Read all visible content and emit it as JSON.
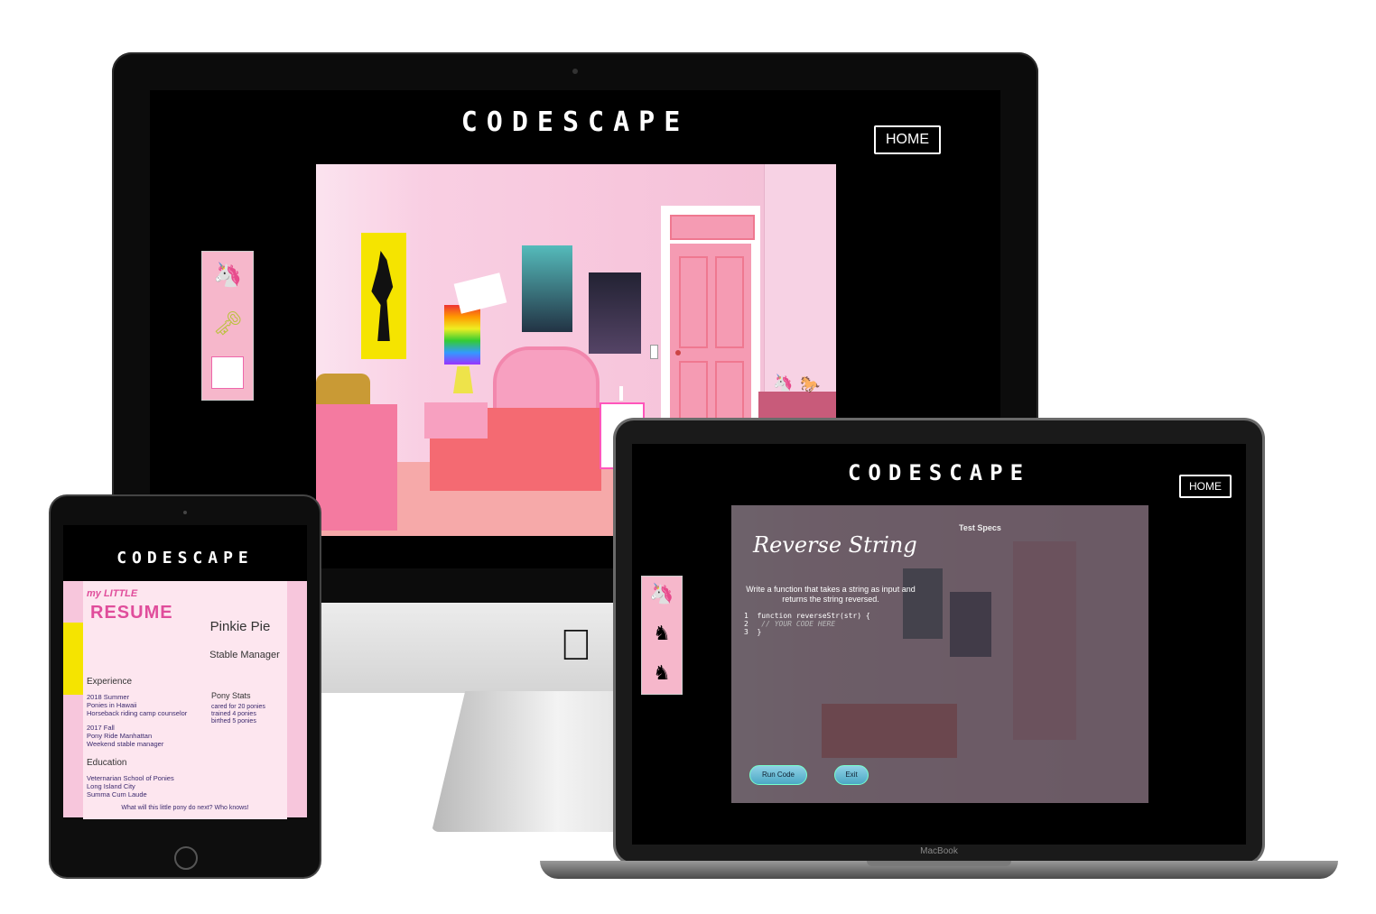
{
  "brand": {
    "title": "CODESCAPE"
  },
  "nav": {
    "home_label": "HOME"
  },
  "macbook": {
    "label": "MacBook"
  },
  "challenge": {
    "title": "Reverse String",
    "test_specs_label": "Test Specs",
    "prompt": "Write a function that takes a string as input and returns the string reversed.",
    "code_lines": [
      {
        "num": "1",
        "text": "function reverseStr(str) {"
      },
      {
        "num": "2",
        "text": "  // YOUR CODE HERE"
      },
      {
        "num": "3",
        "text": "}"
      }
    ],
    "run_label": "Run Code",
    "exit_label": "Exit"
  },
  "resume": {
    "brand_top": "my LITTLE",
    "brand_bottom": "RESUME",
    "name": "Pinkie Pie",
    "role": "Stable Manager",
    "experience_heading": "Experience",
    "exp1_line1": "2018 Summer",
    "exp1_line2": "Ponies in Hawaii",
    "exp1_line3": "Horseback riding camp counselor",
    "exp2_line1": "2017 Fall",
    "exp2_line2": "Pony Ride Manhattan",
    "exp2_line3": "Weekend stable manager",
    "stats_heading": "Pony Stats",
    "stat1": "cared for 20 ponies",
    "stat2": "trained 4 ponies",
    "stat3": "birthed 5 ponies",
    "education_heading": "Education",
    "edu1": "Veternarian School of Ponies",
    "edu2": "Long Island City",
    "edu3": "Summa Cum Laude",
    "footer": "What will this little pony do next? Who knows!"
  },
  "colors": {
    "room_pink": "#f7c6dc",
    "door_pink": "#f59bb3",
    "bed_coral": "#f46a72",
    "dresser_pink": "#f47aa0"
  }
}
